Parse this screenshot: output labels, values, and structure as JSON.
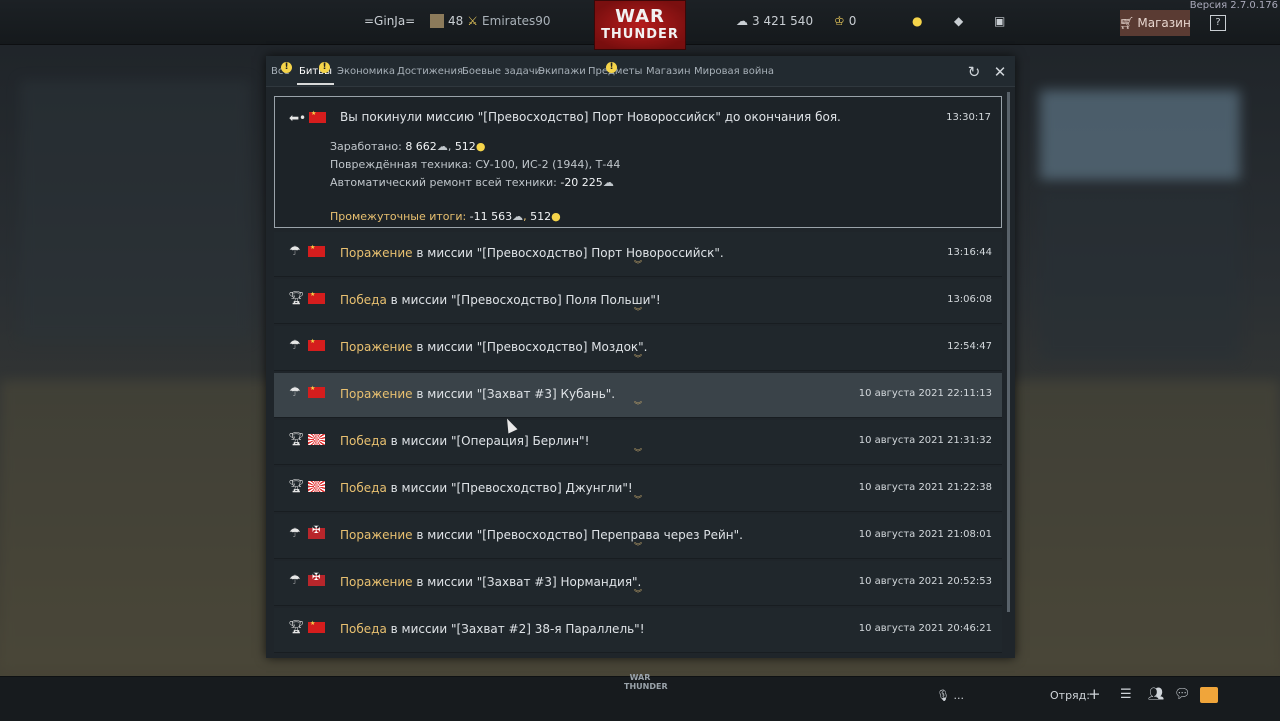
{
  "topbar": {
    "player_name": "=GinJa=",
    "rank": "48",
    "squadron": "Emirates90",
    "logo_line1": "WAR",
    "logo_line2": "THUNDER",
    "silver_lions": "3 421 540",
    "golden_eagles": "0",
    "shop_label": "Магазин",
    "version": "Версия 2.7.0.176"
  },
  "tabs": [
    {
      "label": "Все",
      "warn": true
    },
    {
      "label": "Битвы",
      "warn": true,
      "active": true
    },
    {
      "label": "Экономика"
    },
    {
      "label": "Достижения"
    },
    {
      "label": "Боевые задачи"
    },
    {
      "label": "Экипажи"
    },
    {
      "label": "Предметы",
      "warn": true
    },
    {
      "label": "Магазин"
    },
    {
      "label": "Мировая война"
    }
  ],
  "expanded": {
    "message": "Вы покинули миссию \"[Превосходство] Порт Новороссийск\" до окончания боя.",
    "time": "13:30:17",
    "earned_label": "Заработано:",
    "earned_silver": "8 662",
    "earned_rp": "512",
    "damaged_label": "Повреждённая техника:",
    "damaged_value": "СУ-100, ИС-2 (1944), Т-44",
    "repair_label": "Автоматический ремонт всей техники:",
    "repair_value": "-20 225",
    "subtotal_label": "Промежуточные итоги:",
    "subtotal_silver": "-11 563",
    "subtotal_rp": "512"
  },
  "rows": [
    {
      "result": "Поражение",
      "text": " в миссии \"[Превосходство] Порт Новороссийск\".",
      "time": "13:16:44",
      "icon": "parachute-icon",
      "flag": "ussr"
    },
    {
      "result": "Победа",
      "text": " в миссии \"[Превосходство] Поля Польши\"!",
      "time": "13:06:08",
      "icon": "trophy-icon",
      "flag": "ussr"
    },
    {
      "result": "Поражение",
      "text": " в миссии \"[Превосходство] Моздок\".",
      "time": "12:54:47",
      "icon": "parachute-icon",
      "flag": "ussr"
    },
    {
      "result": "Поражение",
      "text": " в миссии \"[Захват #3] Кубань\".",
      "time": "10 августа 2021 22:11:13",
      "icon": "parachute-icon",
      "flag": "ussr",
      "hover": true
    },
    {
      "result": "Победа",
      "text": " в миссии \"[Операция] Берлин\"!",
      "time": "10 августа 2021 21:31:32",
      "icon": "trophy-icon",
      "flag": "japan"
    },
    {
      "result": "Победа",
      "text": " в миссии \"[Превосходство] Джунгли\"!",
      "time": "10 августа 2021 21:22:38",
      "icon": "trophy-icon",
      "flag": "japan"
    },
    {
      "result": "Поражение",
      "text": " в миссии \"[Превосходство] Переправа через Рейн\".",
      "time": "10 августа 2021 21:08:01",
      "icon": "parachute-icon",
      "flag": "germany"
    },
    {
      "result": "Поражение",
      "text": " в миссии \"[Захват #3] Нормандия\".",
      "time": "10 августа 2021 20:52:53",
      "icon": "parachute-icon",
      "flag": "germany"
    },
    {
      "result": "Победа",
      "text": " в миссии \"[Захват #2] 38-я Параллель\"!",
      "time": "10 августа 2021 20:46:21",
      "icon": "trophy-icon",
      "flag": "ussr"
    }
  ],
  "bottombar": {
    "voice_label": "...",
    "squad_label": "Отряд:",
    "logo_line1": "WAR",
    "logo_line2": "THUNDER"
  }
}
